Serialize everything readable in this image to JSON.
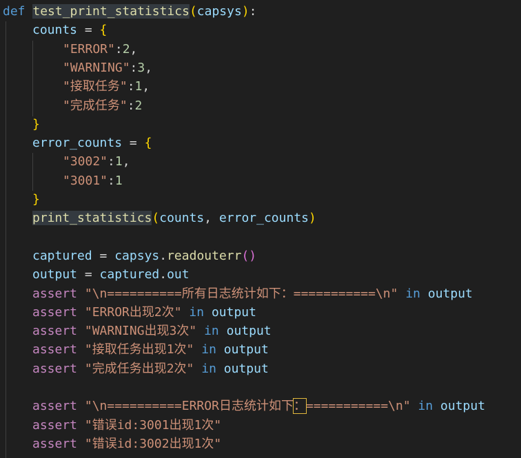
{
  "editor": {
    "lines": [
      {
        "indent": 0,
        "tokens": [
          {
            "t": "def",
            "c": "kw"
          },
          {
            "t": " ",
            "c": "plain"
          },
          {
            "t": "test_print_statistics",
            "c": "fn hl"
          },
          {
            "t": "(",
            "c": "br"
          },
          {
            "t": "capsys",
            "c": "var"
          },
          {
            "t": ")",
            "c": "br"
          },
          {
            "t": ":",
            "c": "plain"
          }
        ]
      },
      {
        "indent": 1,
        "tokens": [
          {
            "t": "counts",
            "c": "var"
          },
          {
            "t": " = ",
            "c": "plain"
          },
          {
            "t": "{",
            "c": "br"
          }
        ]
      },
      {
        "indent": 2,
        "tokens": [
          {
            "t": "\"ERROR\"",
            "c": "str"
          },
          {
            "t": ":",
            "c": "plain"
          },
          {
            "t": "2",
            "c": "num"
          },
          {
            "t": ",",
            "c": "plain"
          }
        ]
      },
      {
        "indent": 2,
        "tokens": [
          {
            "t": "\"WARNING\"",
            "c": "str"
          },
          {
            "t": ":",
            "c": "plain"
          },
          {
            "t": "3",
            "c": "num"
          },
          {
            "t": ",",
            "c": "plain"
          }
        ]
      },
      {
        "indent": 2,
        "tokens": [
          {
            "t": "\"接取任务\"",
            "c": "str"
          },
          {
            "t": ":",
            "c": "plain"
          },
          {
            "t": "1",
            "c": "num"
          },
          {
            "t": ",",
            "c": "plain"
          }
        ]
      },
      {
        "indent": 2,
        "tokens": [
          {
            "t": "\"完成任务\"",
            "c": "str"
          },
          {
            "t": ":",
            "c": "plain"
          },
          {
            "t": "2",
            "c": "num"
          }
        ]
      },
      {
        "indent": 1,
        "tokens": [
          {
            "t": "}",
            "c": "br"
          }
        ]
      },
      {
        "indent": 1,
        "tokens": [
          {
            "t": "error_counts",
            "c": "var"
          },
          {
            "t": " = ",
            "c": "plain"
          },
          {
            "t": "{",
            "c": "br"
          }
        ]
      },
      {
        "indent": 2,
        "tokens": [
          {
            "t": "\"3002\"",
            "c": "str"
          },
          {
            "t": ":",
            "c": "plain"
          },
          {
            "t": "1",
            "c": "num"
          },
          {
            "t": ",",
            "c": "plain"
          }
        ]
      },
      {
        "indent": 2,
        "tokens": [
          {
            "t": "\"3001\"",
            "c": "str"
          },
          {
            "t": ":",
            "c": "plain"
          },
          {
            "t": "1",
            "c": "num"
          }
        ]
      },
      {
        "indent": 1,
        "tokens": [
          {
            "t": "}",
            "c": "br"
          }
        ]
      },
      {
        "indent": 1,
        "tokens": [
          {
            "t": "print_statistics",
            "c": "fn hl"
          },
          {
            "t": "(",
            "c": "br"
          },
          {
            "t": "counts",
            "c": "var"
          },
          {
            "t": ", ",
            "c": "plain"
          },
          {
            "t": "error_counts",
            "c": "var"
          },
          {
            "t": ")",
            "c": "br"
          }
        ]
      },
      {
        "indent": 1,
        "tokens": []
      },
      {
        "indent": 1,
        "tokens": [
          {
            "t": "captured",
            "c": "var"
          },
          {
            "t": " = ",
            "c": "plain"
          },
          {
            "t": "capsys",
            "c": "var"
          },
          {
            "t": ".",
            "c": "plain"
          },
          {
            "t": "readouterr",
            "c": "fn"
          },
          {
            "t": "()",
            "c": "br2"
          }
        ]
      },
      {
        "indent": 1,
        "tokens": [
          {
            "t": "output",
            "c": "var"
          },
          {
            "t": " = ",
            "c": "plain"
          },
          {
            "t": "captured",
            "c": "var"
          },
          {
            "t": ".",
            "c": "plain"
          },
          {
            "t": "out",
            "c": "var"
          }
        ]
      },
      {
        "indent": 1,
        "tokens": [
          {
            "t": "assert",
            "c": "ctl"
          },
          {
            "t": " ",
            "c": "plain"
          },
          {
            "t": "\"\\n==========所有日志统计如下：===========\\n\"",
            "c": "str"
          },
          {
            "t": " ",
            "c": "plain"
          },
          {
            "t": "in",
            "c": "kw"
          },
          {
            "t": " ",
            "c": "plain"
          },
          {
            "t": "output",
            "c": "var"
          }
        ]
      },
      {
        "indent": 1,
        "tokens": [
          {
            "t": "assert",
            "c": "ctl"
          },
          {
            "t": " ",
            "c": "plain"
          },
          {
            "t": "\"ERROR出现2次\"",
            "c": "str"
          },
          {
            "t": " ",
            "c": "plain"
          },
          {
            "t": "in",
            "c": "kw"
          },
          {
            "t": " ",
            "c": "plain"
          },
          {
            "t": "output",
            "c": "var"
          }
        ]
      },
      {
        "indent": 1,
        "tokens": [
          {
            "t": "assert",
            "c": "ctl"
          },
          {
            "t": " ",
            "c": "plain"
          },
          {
            "t": "\"WARNING出现3次\"",
            "c": "str"
          },
          {
            "t": " ",
            "c": "plain"
          },
          {
            "t": "in",
            "c": "kw"
          },
          {
            "t": " ",
            "c": "plain"
          },
          {
            "t": "output",
            "c": "var"
          }
        ]
      },
      {
        "indent": 1,
        "tokens": [
          {
            "t": "assert",
            "c": "ctl"
          },
          {
            "t": " ",
            "c": "plain"
          },
          {
            "t": "\"接取任务出现1次\"",
            "c": "str"
          },
          {
            "t": " ",
            "c": "plain"
          },
          {
            "t": "in",
            "c": "kw"
          },
          {
            "t": " ",
            "c": "plain"
          },
          {
            "t": "output",
            "c": "var"
          }
        ]
      },
      {
        "indent": 1,
        "tokens": [
          {
            "t": "assert",
            "c": "ctl"
          },
          {
            "t": " ",
            "c": "plain"
          },
          {
            "t": "\"完成任务出现2次\"",
            "c": "str"
          },
          {
            "t": " ",
            "c": "plain"
          },
          {
            "t": "in",
            "c": "kw"
          },
          {
            "t": " ",
            "c": "plain"
          },
          {
            "t": "output",
            "c": "var"
          }
        ]
      },
      {
        "indent": 1,
        "tokens": []
      },
      {
        "indent": 1,
        "tokens": [
          {
            "t": "assert",
            "c": "ctl"
          },
          {
            "t": " ",
            "c": "plain"
          },
          {
            "t": "\"\\n==========ERROR日志统计如下",
            "c": "str"
          },
          {
            "t": "：",
            "c": "str boxed"
          },
          {
            "t": "===========\\n\"",
            "c": "str"
          },
          {
            "t": " ",
            "c": "plain"
          },
          {
            "t": "in",
            "c": "kw"
          },
          {
            "t": " ",
            "c": "plain"
          },
          {
            "t": "output",
            "c": "var"
          }
        ]
      },
      {
        "indent": 1,
        "tokens": [
          {
            "t": "assert",
            "c": "ctl"
          },
          {
            "t": " ",
            "c": "plain"
          },
          {
            "t": "\"错误id:3001出现1次\"",
            "c": "str"
          }
        ]
      },
      {
        "indent": 1,
        "tokens": [
          {
            "t": "assert",
            "c": "ctl"
          },
          {
            "t": " ",
            "c": "plain"
          },
          {
            "t": "\"错误id:3002出现1次\"",
            "c": "str"
          }
        ]
      }
    ]
  }
}
